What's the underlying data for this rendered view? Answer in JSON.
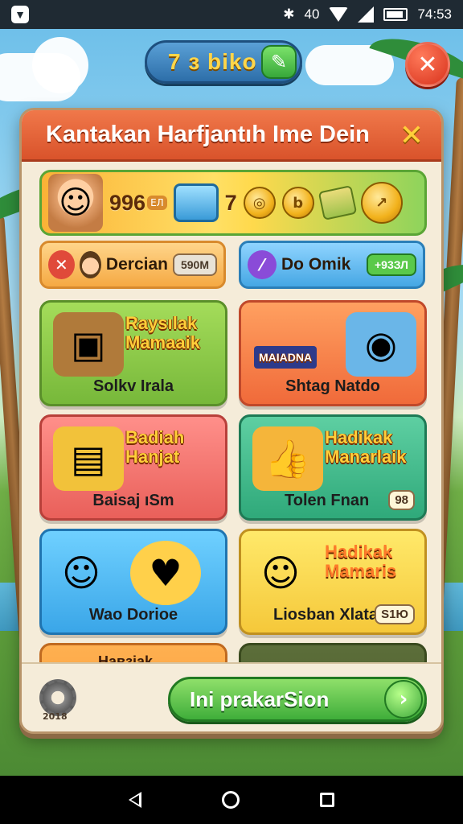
{
  "status_bar": {
    "time": "74:53",
    "bluetooth_icon": "bluetooth-icon",
    "network_label": "40"
  },
  "hud": {
    "coin_value": "7 з biko",
    "plus_icon": "add-coins-icon",
    "close_icon": "close-icon"
  },
  "panel": {
    "title": "Kantakan Harfjantıh Ime Dein",
    "close_icon": "close-x-icon",
    "resources": {
      "primary_value": "996",
      "primary_tag": "ЕЛ",
      "secondary_value": "7"
    },
    "mini_items": [
      {
        "label": "Dercian",
        "badge": "590M",
        "icon": "cancel-icon",
        "color": "#e04a3a"
      },
      {
        "label": "Do Omik",
        "badge": "+93ЗЛ",
        "icon": "magic-wand-icon",
        "color": "#8a4bd8"
      }
    ],
    "cards": [
      {
        "title": "Raysılak Mamaaik",
        "caption": "Solkv Irala",
        "tag": "",
        "icon": "wallet-icon"
      },
      {
        "title": "",
        "caption": "Shtag Natdo",
        "tag": "",
        "banner": "MAIADNA",
        "icon": "treasure-box-icon"
      },
      {
        "title": "Badiah Hanjat",
        "caption": "Baisaj ıSm",
        "tag": "",
        "icon": "money-stack-icon"
      },
      {
        "title": "Hadikak Manarlaik",
        "caption": "Tolen Fnan",
        "tag": "98",
        "icon": "thumbs-up-icon"
      },
      {
        "title": "",
        "caption": "Wao Dorioe",
        "tag": "",
        "icon": "heart-badge-icon"
      },
      {
        "title": "Hadikak Mamaris",
        "caption": "Liosban Xlata",
        "tag": "S1Ю",
        "icon": "gift-icon"
      }
    ],
    "partial_card_title": "Навзіak",
    "settings_caption": "2018",
    "cta_label": "Ini prakarSion",
    "cta_arrow": "arrow-right-icon"
  },
  "colors": {
    "header": "#e0603a",
    "panel_bg": "#f5ecd9",
    "cta_green": "#4cbc3e",
    "title_yellow": "#ffcf3a"
  }
}
